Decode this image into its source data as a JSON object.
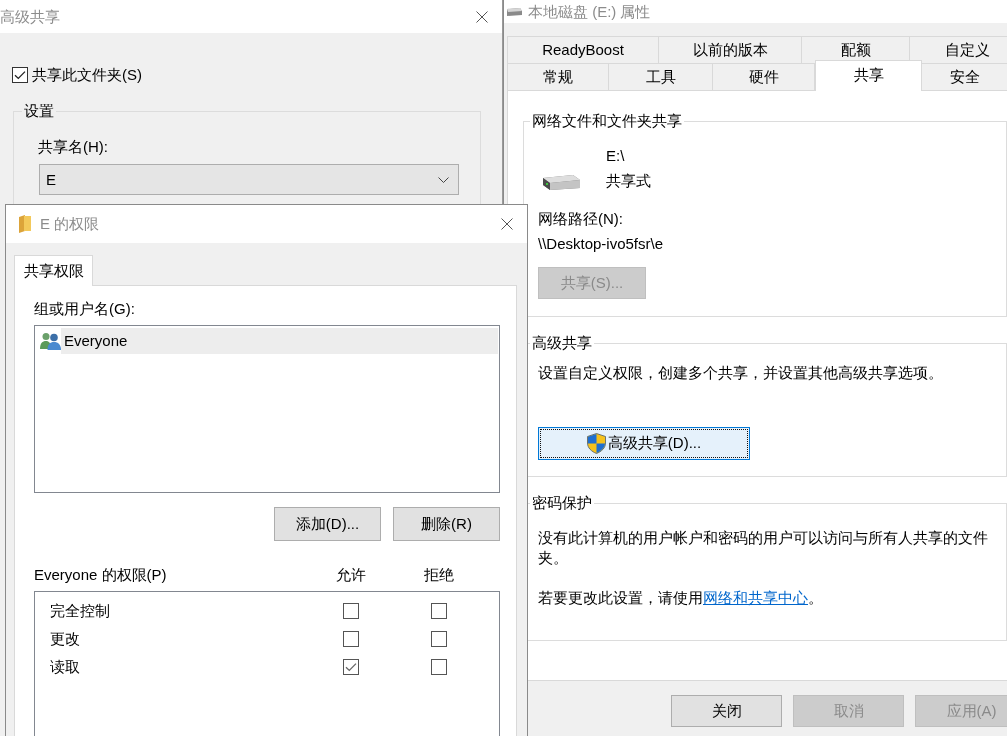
{
  "advanced_sharing_window": {
    "title": "高级共享",
    "share_folder": {
      "label": "共享此文件夹(S)",
      "checked": true
    },
    "settings": {
      "title": "设置",
      "share_name_label": "共享名(H):",
      "share_name_value": "E"
    }
  },
  "properties_window": {
    "title": "本地磁盘 (E:) 属性",
    "tab_rows": [
      [
        {
          "label": "ReadyBoost",
          "selected": false
        },
        {
          "label": "以前的版本",
          "selected": false
        },
        {
          "label": "配额",
          "selected": false
        },
        {
          "label": "自定义",
          "selected": false
        }
      ],
      [
        {
          "label": "常规",
          "selected": false
        },
        {
          "label": "工具",
          "selected": false
        },
        {
          "label": "硬件",
          "selected": false
        },
        {
          "label": "共享",
          "selected": true
        },
        {
          "label": "安全",
          "selected": false
        }
      ]
    ],
    "network_sharing": {
      "title": "网络文件和文件夹共享",
      "drive": "E:\\",
      "status": "共享式",
      "path_label": "网络路径(N):",
      "path": "\\\\Desktop-ivo5fsr\\e",
      "share_button": {
        "label": "共享(S)...",
        "disabled": true
      }
    },
    "advanced_sharing": {
      "title": "高级共享",
      "description": "设置自定义权限，创建多个共享，并设置其他高级共享选项。",
      "button": {
        "label": "高级共享(D)...",
        "focused": true
      }
    },
    "password_protection": {
      "title": "密码保护",
      "description": "没有此计算机的用户帐户和密码的用户可以访问与所有人共享的文件夹。",
      "change_prefix": "若要更改此设置，请使用",
      "link": "网络和共享中心",
      "change_suffix": "。"
    },
    "buttons": [
      {
        "label": "关闭",
        "disabled": false
      },
      {
        "label": "取消",
        "disabled": true
      },
      {
        "label": "应用(A)",
        "disabled": true
      }
    ]
  },
  "permissions_window": {
    "title": "E 的权限",
    "tabs": [
      {
        "label": "共享权限",
        "selected": true
      }
    ],
    "users_label": "组或用户名(G):",
    "users": [
      {
        "name": "Everyone",
        "selected": true
      }
    ],
    "buttons": [
      {
        "label": "添加(D)..."
      },
      {
        "label": "删除(R)"
      }
    ],
    "permissions_label": "Everyone 的权限(P)",
    "columns": [
      "允许",
      "拒绝"
    ],
    "permissions": [
      {
        "name": "完全控制",
        "allow": false,
        "deny": false
      },
      {
        "name": "更改",
        "allow": false,
        "deny": false
      },
      {
        "name": "读取",
        "allow": true,
        "deny": false
      }
    ]
  }
}
